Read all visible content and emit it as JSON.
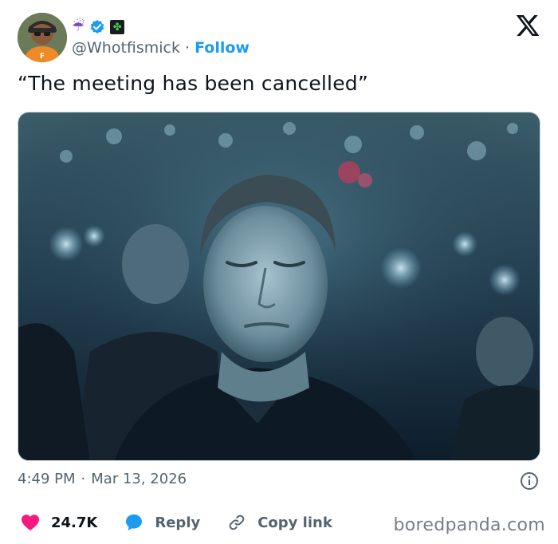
{
  "author": {
    "handle": "@Whotfismick",
    "follow_label": "Follow",
    "separator": "·",
    "name_emoji": "☔",
    "badges": [
      "verified-icon",
      "clover-icon"
    ],
    "avatar_icon": "avatar-cartoon-icon"
  },
  "tweet": {
    "text": "“The meeting has been cancelled”",
    "media_icon": "photo-nightclub"
  },
  "meta": {
    "time": "4:49 PM",
    "separator": "·",
    "date": "Mar 13, 2026"
  },
  "actions": {
    "likes": "24.7K",
    "reply_label": "Reply",
    "copy_label": "Copy link"
  },
  "watermark": "boredpanda.com",
  "colors": {
    "accent": "#1d9bf0",
    "heart": "#f91880",
    "secondary_text": "#536471"
  }
}
